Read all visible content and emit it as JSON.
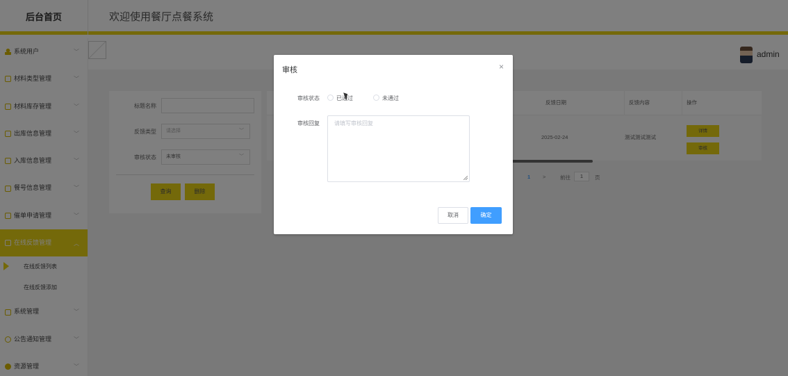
{
  "header": {
    "brand": "后台首页",
    "welcome": "欢迎使用餐厅点餐系统"
  },
  "sidebar": {
    "items": [
      {
        "label": "系统用户",
        "icon": "user-icon"
      },
      {
        "label": "材料类型管理",
        "icon": "edit-icon"
      },
      {
        "label": "材料库存管理",
        "icon": "edit-icon"
      },
      {
        "label": "出库信息管理",
        "icon": "edit-icon"
      },
      {
        "label": "入库信息管理",
        "icon": "edit-icon"
      },
      {
        "label": "餐号信息管理",
        "icon": "edit-icon"
      },
      {
        "label": "催单申请管理",
        "icon": "edit-icon"
      },
      {
        "label": "在线反馈管理",
        "icon": "edit-icon",
        "active": true
      },
      {
        "label": "系统管理",
        "icon": "image-icon"
      },
      {
        "label": "公告通知管理",
        "icon": "info-icon"
      },
      {
        "label": "资源管理",
        "icon": "dot-icon"
      }
    ],
    "sub_items": [
      "在线反馈列表",
      "在线反馈添加"
    ]
  },
  "topbar": {
    "username": "admin"
  },
  "search": {
    "title_label": "标题名称",
    "title_value": "",
    "type_label": "反馈类型",
    "type_placeholder": "请选择",
    "status_label": "审核状态",
    "status_value": "未审核",
    "query_button": "查询",
    "delete_button": "删除"
  },
  "table": {
    "columns": [
      "反馈日期",
      "反馈内容",
      "操作"
    ],
    "rows": [
      {
        "date": "2025-02-24",
        "content": "测试测试测试",
        "detail": "详情",
        "review": "审核"
      }
    ]
  },
  "pager": {
    "current": "1",
    "next": ">",
    "goto": "前往",
    "page_input": "1",
    "page_suffix": "页"
  },
  "dialog": {
    "title": "审核",
    "close": "×",
    "status_label": "审核状态",
    "option_pass": "已通过",
    "option_fail": "未通过",
    "reply_label": "审核回复",
    "reply_placeholder": "请填写审核回复",
    "cancel": "取消",
    "confirm": "确定"
  },
  "colors": {
    "accent": "#e8d215",
    "primary": "#409eff",
    "overlay": "rgba(0,0,0,0.5)"
  }
}
